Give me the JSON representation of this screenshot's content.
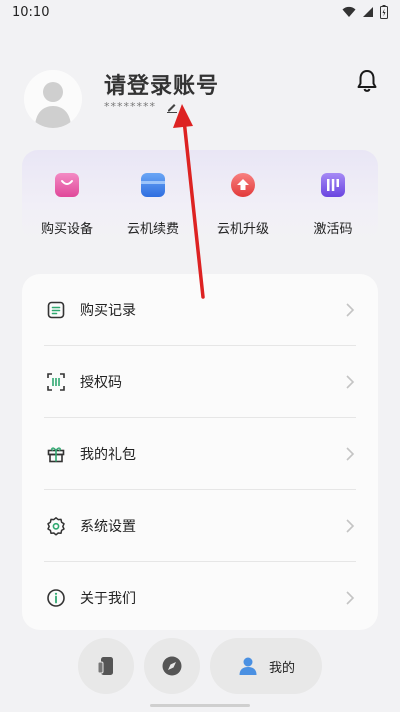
{
  "status_bar": {
    "time": "10:10",
    "icons": [
      "wifi-icon",
      "signal-icon",
      "battery-icon"
    ]
  },
  "profile": {
    "username": "请登录账号",
    "password_mask": "********",
    "icons": [
      "avatar-icon",
      "edit-icon",
      "bell-icon"
    ]
  },
  "quick_actions": [
    {
      "label": "购买设备",
      "icon": "shopping-bag-icon",
      "color": "#e85aa8"
    },
    {
      "label": "云机续费",
      "icon": "card-icon",
      "color": "#3b7be8"
    },
    {
      "label": "云机升级",
      "icon": "upgrade-icon",
      "color": "#f04e4e"
    },
    {
      "label": "激活码",
      "icon": "code-icon",
      "color": "#7a56e8"
    }
  ],
  "menu": [
    {
      "label": "购买记录",
      "icon": "receipt-icon"
    },
    {
      "label": "授权码",
      "icon": "scan-icon"
    },
    {
      "label": "我的礼包",
      "icon": "gift-icon"
    },
    {
      "label": "系统设置",
      "icon": "gear-icon"
    },
    {
      "label": "关于我们",
      "icon": "info-icon"
    }
  ],
  "bottom_nav": {
    "items": [
      {
        "label": "",
        "icon": "phone-icon"
      },
      {
        "label": "",
        "icon": "compass-icon"
      },
      {
        "label": "我的",
        "icon": "person-icon",
        "active": true
      }
    ]
  },
  "colors": {
    "background": "#f2f2f4",
    "card": "#fbfbfb",
    "annotation_arrow": "#dd2222",
    "person_icon": "#4a90e2"
  }
}
